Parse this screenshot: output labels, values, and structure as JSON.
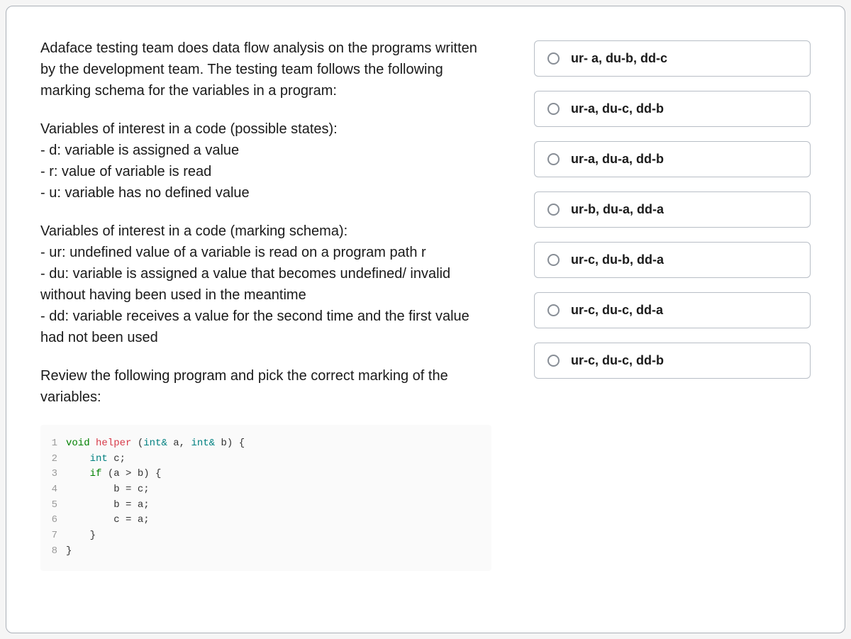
{
  "question": {
    "intro": "Adaface testing team does data flow analysis on the programs written by the development team. The testing team follows the following marking schema for the variables in a program:",
    "states_heading": "Variables of interest in a code (possible states):",
    "state_d": "- d: variable is assigned a value",
    "state_r": "- r: value of variable is read",
    "state_u": "- u: variable has no defined value",
    "schema_heading": "Variables of interest in a code (marking schema):",
    "schema_ur": "- ur: undefined value of a variable is read on a program path r",
    "schema_du": "- du: variable is assigned a value that becomes undefined/ invalid without having been used in the meantime",
    "schema_dd": "- dd: variable receives a value for the second time and the first value had not been used",
    "prompt": "Review the following program and pick the correct marking of the variables:"
  },
  "code": {
    "lines": [
      {
        "n": "1",
        "tokens": [
          [
            "kw",
            "void "
          ],
          [
            "fn",
            "helper "
          ],
          [
            "punc",
            "("
          ],
          [
            "type",
            "int& "
          ],
          [
            "id",
            "a"
          ],
          [
            "punc",
            ", "
          ],
          [
            "type",
            "int& "
          ],
          [
            "id",
            "b"
          ],
          [
            "punc",
            ") {"
          ]
        ]
      },
      {
        "n": "2",
        "tokens": [
          [
            "id",
            "    "
          ],
          [
            "type",
            "int "
          ],
          [
            "id",
            "c"
          ],
          [
            "punc",
            ";"
          ]
        ]
      },
      {
        "n": "3",
        "tokens": [
          [
            "id",
            "    "
          ],
          [
            "kw",
            "if "
          ],
          [
            "punc",
            "(a > b) {"
          ]
        ]
      },
      {
        "n": "4",
        "tokens": [
          [
            "id",
            "        b = c;"
          ]
        ]
      },
      {
        "n": "5",
        "tokens": [
          [
            "id",
            "        b = a;"
          ]
        ]
      },
      {
        "n": "6",
        "tokens": [
          [
            "id",
            "        c = a;"
          ]
        ]
      },
      {
        "n": "7",
        "tokens": [
          [
            "id",
            "    }"
          ]
        ]
      },
      {
        "n": "8",
        "tokens": [
          [
            "id",
            "}"
          ]
        ]
      }
    ]
  },
  "options": [
    {
      "label": "ur- a, du-b, dd-c"
    },
    {
      "label": "ur-a, du-c, dd-b"
    },
    {
      "label": "ur-a, du-a, dd-b"
    },
    {
      "label": "ur-b, du-a, dd-a"
    },
    {
      "label": "ur-c, du-b, dd-a"
    },
    {
      "label": "ur-c, du-c, dd-a"
    },
    {
      "label": "ur-c, du-c, dd-b"
    }
  ]
}
